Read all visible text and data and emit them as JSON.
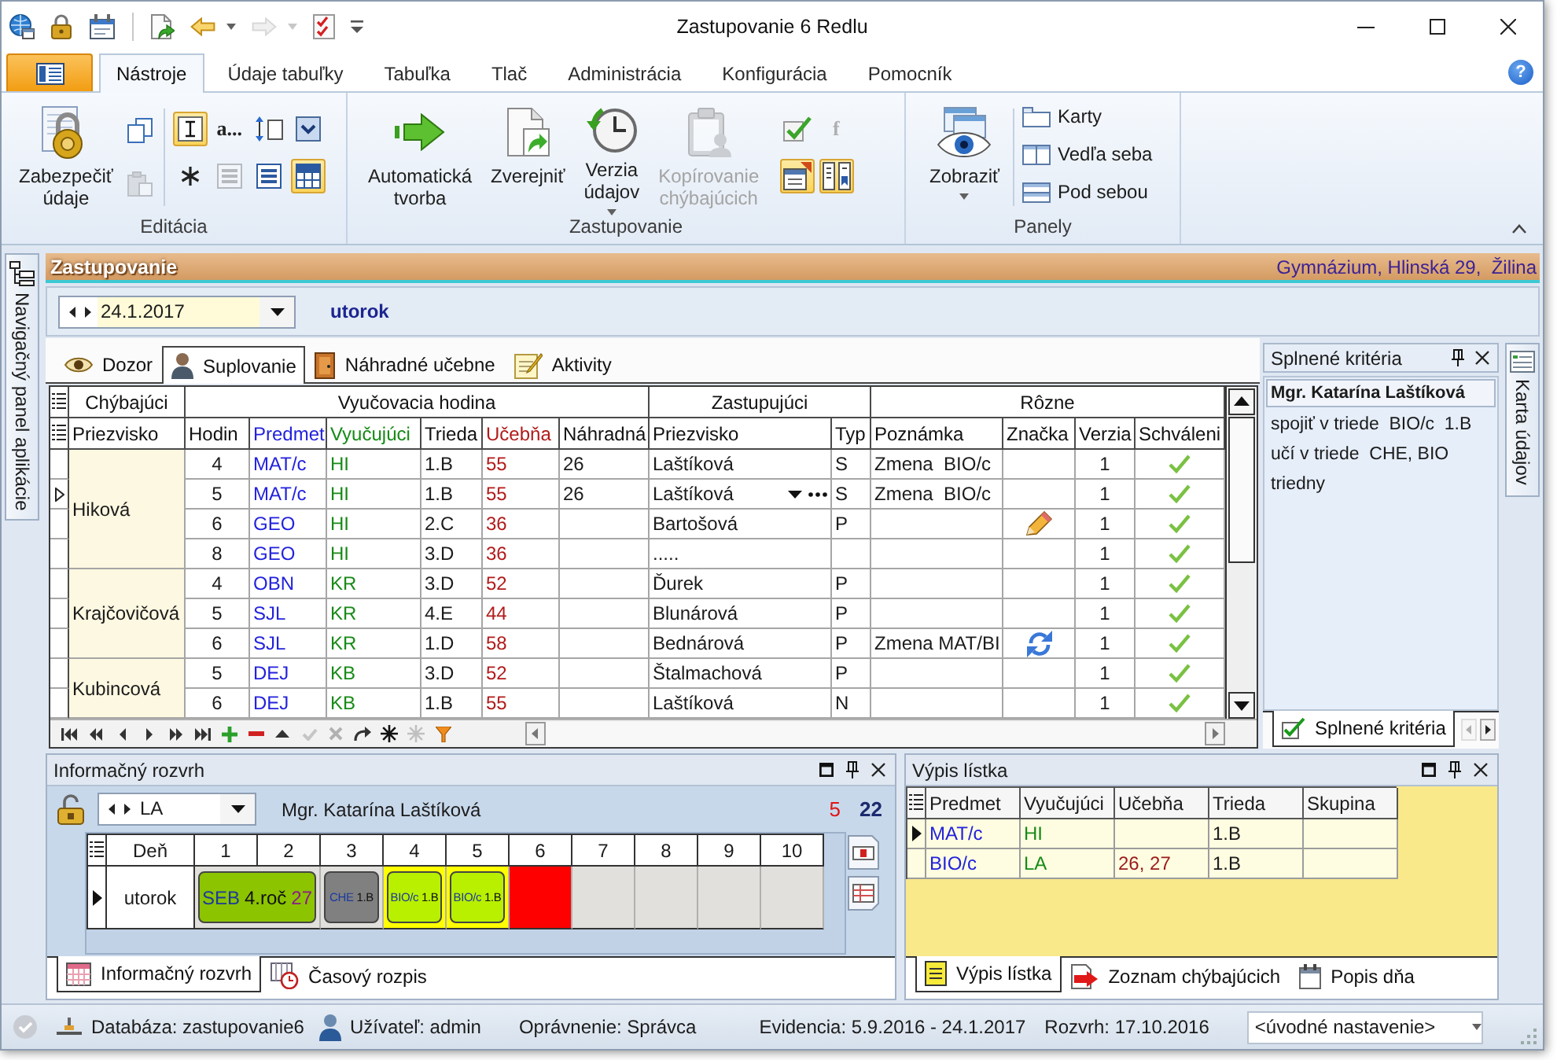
{
  "window": {
    "title": "Zastupovanie 6 Redlu"
  },
  "quick_access": [
    {
      "kind": "button",
      "disabled": false
    },
    {
      "kind": "button",
      "disabled": false
    },
    {
      "kind": "button",
      "disabled": false
    },
    {
      "kind": "separator"
    },
    {
      "kind": "button",
      "disabled": false
    },
    {
      "kind": "split",
      "disabled": false
    },
    {
      "kind": "split",
      "disabled": true
    },
    {
      "kind": "button",
      "disabled": false
    },
    {
      "kind": "menu"
    }
  ],
  "ribbon": {
    "tabs": [
      {
        "label": "Nástroje",
        "selected": true
      },
      {
        "label": "Údaje tabuľky",
        "selected": false
      },
      {
        "label": "Tabuľka",
        "selected": false
      },
      {
        "label": "Tlač",
        "selected": false
      },
      {
        "label": "Administrácia",
        "selected": false
      },
      {
        "label": "Konfigurácia",
        "selected": false
      },
      {
        "label": "Pomocník",
        "selected": false
      }
    ],
    "help": "?",
    "groups": [
      {
        "label": "Editácia",
        "items": [
          {
            "kind": "large",
            "label": "Zabezpečiť údaje",
            "disabled": false
          },
          {
            "kind": "column",
            "buttons": [
              {
                "disabled": false
              },
              {
                "disabled": true
              }
            ]
          },
          {
            "kind": "separator"
          },
          {
            "kind": "grid",
            "buttons": [
              {
                "on": true,
                "disabled": false
              },
              {
                "on": false,
                "disabled": false,
                "text": "a..."
              },
              {
                "on": false,
                "disabled": false
              },
              {
                "on": false,
                "disabled": false
              },
              {
                "on": false,
                "disabled": false
              },
              {
                "on": false,
                "disabled": true
              },
              {
                "on": false,
                "disabled": false
              },
              {
                "on": true,
                "disabled": false
              }
            ]
          }
        ]
      },
      {
        "label": "Zastupovanie",
        "items": [
          {
            "kind": "large",
            "label": "Automatická tvorba",
            "disabled": false
          },
          {
            "kind": "large",
            "label": "Zverejniť",
            "disabled": false
          },
          {
            "kind": "large",
            "label": "Verzia údajov",
            "disabled": false,
            "dropdown": true
          },
          {
            "kind": "large",
            "label": "Kopírovanie chýbajúcich",
            "disabled": true
          },
          {
            "kind": "grid",
            "buttons": [
              {
                "on": false,
                "disabled": false
              },
              {
                "on": false,
                "disabled": true,
                "text": "f"
              },
              {
                "on": true,
                "disabled": false
              },
              {
                "on": true,
                "disabled": false
              }
            ]
          }
        ]
      },
      {
        "label": "Panely",
        "items": [
          {
            "kind": "large",
            "label": "Zobraziť",
            "disabled": false,
            "dropdown": true
          },
          {
            "kind": "separator"
          },
          {
            "kind": "list",
            "buttons": [
              {
                "label": "Karty"
              },
              {
                "label": "Vedľa seba"
              },
              {
                "label": "Pod sebou"
              }
            ]
          }
        ]
      }
    ]
  },
  "side_tabs": {
    "navigation": "Navigačný panel aplikácie",
    "data_card": "Karta údajov"
  },
  "substitution": {
    "title": "Zastupovanie",
    "school": "Gymnázium, Hlinská 29,  Žilina",
    "date": "24.1.2017",
    "weekday": "utorok",
    "tabs": [
      {
        "label": "Dozor",
        "selected": false
      },
      {
        "label": "Suplovanie",
        "selected": true
      },
      {
        "label": "Náhradné učebne",
        "selected": false
      },
      {
        "label": "Aktivity",
        "selected": false
      }
    ],
    "grid": {
      "column_groups": [
        {
          "label": "Chýbajúci",
          "columns": [
            "Priezvisko"
          ]
        },
        {
          "label": "Vyučovacia hodina",
          "columns": [
            "Hodin",
            "Predmet",
            "Vyučujúci",
            "Trieda",
            "Učebňa",
            "Náhradná"
          ]
        },
        {
          "label": "Zastupujúci",
          "columns": [
            "Priezvisko",
            "Typ"
          ]
        },
        {
          "label": "Rôzne",
          "columns": [
            "Poznámka",
            "Značka",
            "Verzia",
            "Schváleni"
          ]
        }
      ],
      "absent": [
        {
          "surname": "Hiková",
          "rows": [
            {
              "selected": false,
              "hour": "4",
              "subject": "MAT/c",
              "teacher": "HI",
              "class": "1.B",
              "room": "55",
              "substitute_room": "26",
              "substitute": "Laštíková",
              "type": "S",
              "note": "Zmena  BIO/c",
              "edited": false,
              "exchanged": false,
              "version": "1",
              "approved": true
            },
            {
              "selected": true,
              "hour": "5",
              "subject": "MAT/c",
              "teacher": "HI",
              "class": "1.B",
              "room": "55",
              "substitute_room": "26",
              "substitute": "Laštíková",
              "type": "S",
              "note": "Zmena  BIO/c",
              "edited": false,
              "exchanged": false,
              "version": "1",
              "approved": true
            },
            {
              "selected": false,
              "hour": "6",
              "subject": "GEO",
              "teacher": "HI",
              "class": "2.C",
              "room": "36",
              "substitute": "Bartošová",
              "type": "P",
              "edited": true,
              "exchanged": false,
              "version": "1",
              "approved": true
            },
            {
              "selected": false,
              "hour": "8",
              "subject": "GEO",
              "teacher": "HI",
              "class": "3.D",
              "room": "36",
              "substitute": ".....",
              "edited": false,
              "exchanged": false,
              "version": "1",
              "approved": true
            }
          ]
        },
        {
          "surname": "Krajčovičová",
          "rows": [
            {
              "selected": false,
              "hour": "4",
              "subject": "OBN",
              "teacher": "KR",
              "class": "3.D",
              "room": "52",
              "substitute": "Ďurek",
              "type": "P",
              "edited": false,
              "exchanged": false,
              "version": "1",
              "approved": true
            },
            {
              "selected": false,
              "hour": "5",
              "subject": "SJL",
              "teacher": "KR",
              "class": "4.E",
              "room": "44",
              "substitute": "Blunárová",
              "type": "P",
              "edited": false,
              "exchanged": false,
              "version": "1",
              "approved": true
            },
            {
              "selected": false,
              "hour": "6",
              "subject": "SJL",
              "teacher": "KR",
              "class": "1.D",
              "room": "58",
              "substitute": "Bednárová",
              "type": "P",
              "note": "Zmena MAT/BI",
              "edited": false,
              "exchanged": true,
              "version": "1",
              "approved": true
            }
          ]
        },
        {
          "surname": "Kubincová",
          "rows": [
            {
              "selected": false,
              "hour": "5",
              "subject": "DEJ",
              "teacher": "KB",
              "class": "3.D",
              "room": "52",
              "substitute": "Štalmachová",
              "type": "P",
              "edited": false,
              "exchanged": false,
              "version": "1",
              "approved": true
            },
            {
              "selected": false,
              "hour": "6",
              "subject": "DEJ",
              "teacher": "KB",
              "class": "1.B",
              "room": "55",
              "substitute": "Laštíková",
              "type": "N",
              "edited": false,
              "exchanged": false,
              "version": "1",
              "approved": true
            }
          ]
        }
      ]
    },
    "navigator": [
      {
        "disabled": false
      },
      {
        "disabled": false
      },
      {
        "disabled": false
      },
      {
        "disabled": false
      },
      {
        "disabled": false
      },
      {
        "disabled": false
      },
      {
        "disabled": false
      },
      {
        "disabled": false
      },
      {
        "disabled": false
      },
      {
        "disabled": true
      },
      {
        "disabled": true
      },
      {
        "disabled": false
      },
      {
        "disabled": false
      },
      {
        "disabled": true
      },
      {
        "disabled": false
      }
    ],
    "criteria": {
      "title": "Splnené kritéria",
      "heading": "Mgr. Katarína Laštíková",
      "lines": [
        "spojiť v triede  BIO/c  1.B",
        "učí v triede  CHE, BIO",
        "triedny"
      ],
      "tabs": [
        {
          "label": "Splnené kritéria",
          "selected": true
        }
      ],
      "tab_scroll": [
        {
          "disabled": true
        },
        {
          "disabled": false
        }
      ]
    }
  },
  "schedule": {
    "title": "Informačný rozvrh",
    "teacher": "LA",
    "teacher_name": "Mgr. Katarína Laštíková",
    "counts": [
      {
        "value": "5",
        "color": "#e01414"
      },
      {
        "value": "22",
        "color": "#1c2a6e"
      }
    ],
    "columns": [
      "Deň",
      "1",
      "2",
      "3",
      "4",
      "5",
      "6",
      "7",
      "8",
      "9",
      "10"
    ],
    "rows": [
      {
        "selected": true,
        "cells": [
          {
            "kind": "day",
            "text": "utorok"
          },
          {
            "kind": "lesson",
            "subject": "SEB",
            "class": "4.roč",
            "room": "27",
            "color": "#8cc400",
            "highlighted": false
          },
          {
            "kind": "continuation"
          },
          {
            "kind": "lesson",
            "subject": "CHE",
            "class": "1.B",
            "color": "#808080",
            "highlighted": false
          },
          {
            "kind": "lesson",
            "subject": "BIO/c",
            "class": "1.B",
            "color": "#b8f000",
            "highlighted": true
          },
          {
            "kind": "lesson",
            "subject": "BIO/c",
            "class": "1.B",
            "color": "#b8f000",
            "highlighted": true
          },
          {
            "kind": "marked",
            "color": "#ff0000"
          },
          {
            "kind": "empty"
          },
          {
            "kind": "empty"
          },
          {
            "kind": "empty"
          },
          {
            "kind": "empty"
          }
        ]
      }
    ],
    "tabs": [
      {
        "label": "Informačný rozvrh",
        "selected": true
      },
      {
        "label": "Časový rozpis",
        "selected": false
      }
    ]
  },
  "ticket": {
    "title": "Výpis lístka",
    "columns": [
      "Predmet",
      "Vyučujúci",
      "Učebňa",
      "Trieda",
      "Skupina"
    ],
    "rows": [
      {
        "selected": true,
        "subject": "MAT/c",
        "teacher": "HI",
        "class": "1.B"
      },
      {
        "selected": false,
        "subject": "BIO/c",
        "teacher": "LA",
        "room": "26, 27",
        "class": "1.B"
      }
    ],
    "tabs": [
      {
        "label": "Výpis lístka",
        "selected": true
      },
      {
        "label": "Zoznam chýbajúcich",
        "selected": false
      },
      {
        "label": "Popis dňa",
        "selected": false
      }
    ]
  },
  "status_bar": {
    "database": "Databáza: zastupovanie6",
    "user": "Užívateľ: admin",
    "permission": "Oprávnenie: Správca",
    "records": "Evidencia: 5.9.2016 - 24.1.2017",
    "timetable": "Rozvrh: 17.10.2016",
    "settings": "<úvodné nastavenie>"
  }
}
